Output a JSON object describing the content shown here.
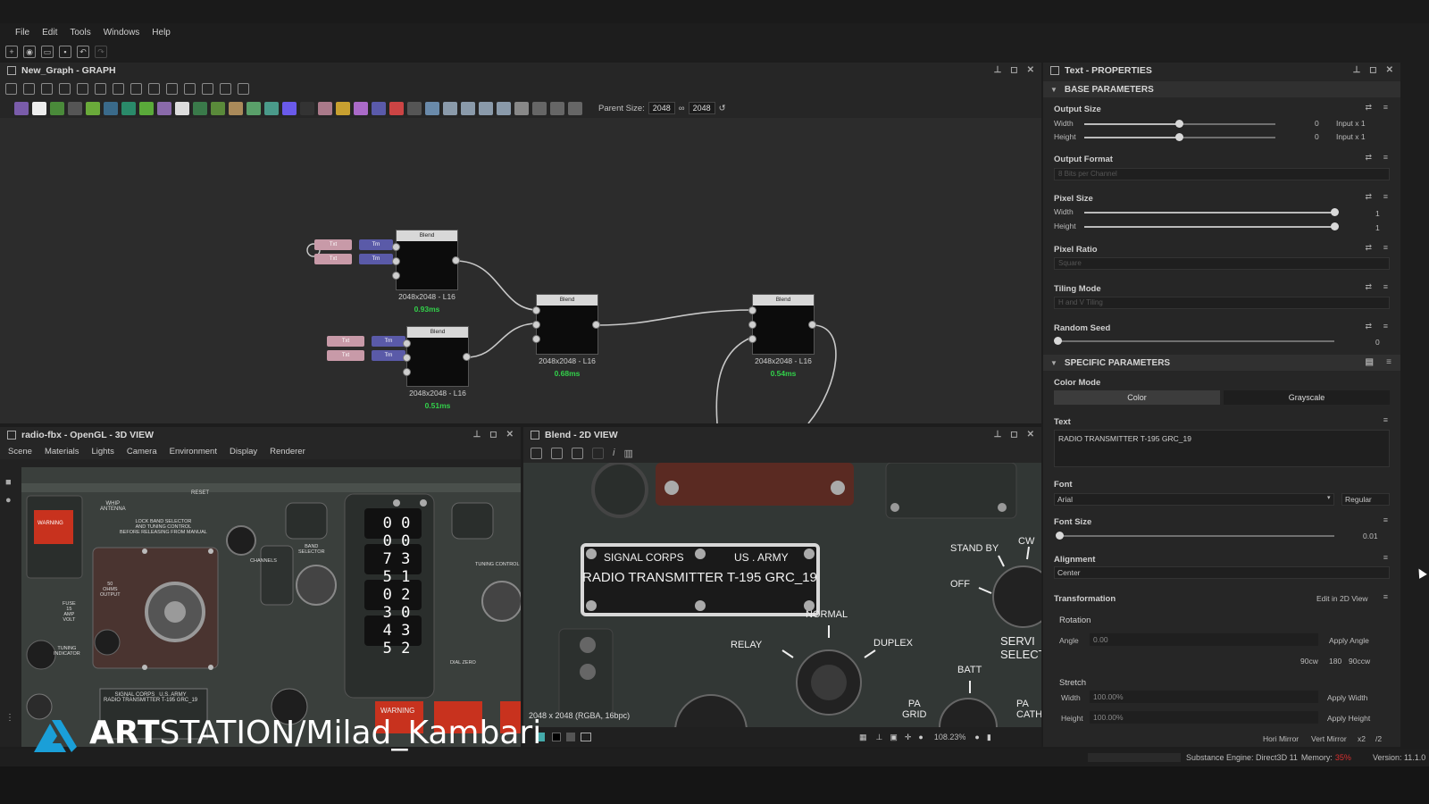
{
  "menu": [
    "File",
    "Edit",
    "Tools",
    "Windows",
    "Help"
  ],
  "graph": {
    "title": "New_Graph - GRAPH",
    "parent_size_label": "Parent Size:",
    "parent_size_w": "2048",
    "parent_size_h": "2048",
    "nodes": [
      {
        "header": "Blend",
        "label": "2048x2048 - L16",
        "time": "0.93ms"
      },
      {
        "header": "Blend",
        "label": "2048x2048 - L16",
        "time": "0.51ms"
      },
      {
        "header": "Blend",
        "label": "2048x2048 - L16",
        "time": "0.68ms"
      },
      {
        "header": "Blend",
        "label": "2048x2048 - L16",
        "time": "0.54ms"
      }
    ],
    "mini_nodes": [
      "Txt",
      "Trn",
      "Txt",
      "Trn",
      "Txt",
      "Trn",
      "Txt",
      "Trn"
    ]
  },
  "view3d": {
    "title": "radio-fbx - OpenGL - 3D VIEW",
    "menu": [
      "Scene",
      "Materials",
      "Lights",
      "Camera",
      "Environment",
      "Display",
      "Renderer"
    ],
    "labels": {
      "whip": "WHIP\nANTENNA",
      "reset": "RESET",
      "lock": "LOCK BAND SELECTOR\nAND TUNING CONTROL\nBEFORE RELEASING FROM MANUAL",
      "channels": "CHANNELS",
      "band": "BAND\nSELECTOR",
      "tuning": "TUNING CONTROL",
      "ohms": "50\nOHMS\nOUTPUT",
      "fuse": "FUSE\n15\nAMP\nVOLT",
      "tuning_ind": "TUNING\nINDICATOR",
      "dial": "DIAL ZERO",
      "plate": "SIGNAL CORPS   U.S. ARMY\nRADIO TRANSMITTER T-195 GRC_19",
      "warning": "WARNING"
    },
    "counters": [
      "0 0 0 0",
      "7 3 5 1",
      "0 2 3 0",
      "4 3 5 2"
    ]
  },
  "view2d": {
    "title": "Blend - 2D VIEW",
    "plate_top_left": "SIGNAL CORPS",
    "plate_top_right": "US . ARMY",
    "plate_main": "RADIO TRANSMITTER T-195 GRC_19",
    "labels": {
      "standby": "STAND BY",
      "cw": "CW",
      "off": "OFF",
      "normal": "NORMAL",
      "relay": "RELAY",
      "duplex": "DUPLEX",
      "service": "SERVI\nSELECT",
      "batt": "BATT",
      "pa_grid": "PA\nGRID",
      "pa_cath": "PA\nCATH"
    },
    "resolution": "2048 x 2048 (RGBA, 16bpc)",
    "zoom": "108.23%"
  },
  "properties": {
    "title": "Text - PROPERTIES",
    "base_parameters": "BASE PARAMETERS",
    "output_size": "Output Size",
    "width": "Width",
    "height": "Height",
    "output_size_w_val": "0",
    "output_size_h_val": "0",
    "output_size_w_suffix": "Input x 1",
    "output_size_h_suffix": "Input x 1",
    "output_format": "Output Format",
    "output_format_val": "8 Bits per Channel",
    "pixel_size": "Pixel Size",
    "pixel_size_w_val": "1",
    "pixel_size_h_val": "1",
    "pixel_ratio": "Pixel Ratio",
    "pixel_ratio_val": "Square",
    "tiling_mode": "Tiling Mode",
    "tiling_mode_val": "H and V Tiling",
    "random_seed": "Random Seed",
    "random_seed_val": "0",
    "specific_parameters": "SPECIFIC PARAMETERS",
    "color_mode": "Color Mode",
    "color_mode_color": "Color",
    "color_mode_grayscale": "Grayscale",
    "text_label": "Text",
    "text_value": "RADIO TRANSMITTER T-195 GRC_19",
    "font": "Font",
    "font_val": "Arial",
    "font_style": "Regular",
    "font_size": "Font Size",
    "font_size_val": "0.01",
    "alignment": "Alignment",
    "alignment_val": "Center",
    "transformation": "Transformation",
    "edit_2d": "Edit in 2D View",
    "rotation": "Rotation",
    "angle": "Angle",
    "angle_val": "0.00",
    "apply_angle": "Apply Angle",
    "rot_90cw": "90cw",
    "rot_180": "180",
    "rot_90ccw": "90ccw",
    "stretch": "Stretch",
    "stretch_w": "Width",
    "stretch_w_val": "100.00%",
    "apply_width": "Apply Width",
    "stretch_h": "Height",
    "stretch_h_val": "100.00%",
    "apply_height": "Apply Height",
    "hori_mirror": "Hori Mirror",
    "vert_mirror": "Vert Mirror",
    "x2": "x2",
    "div2": "/2"
  },
  "status": {
    "engine": "Substance Engine: Direct3D 11",
    "memory_label": "Memory:",
    "memory_val": "35%",
    "version": "Version: 11.1.0"
  },
  "watermark": {
    "bold": "ART",
    "rest": "STATION/Milad_Kambari"
  },
  "colors": {
    "accent_green": "#32d04a",
    "memory_red": "#d83030",
    "mini_pink": "#c89aa8",
    "mini_blue": "#5a5aa8"
  }
}
